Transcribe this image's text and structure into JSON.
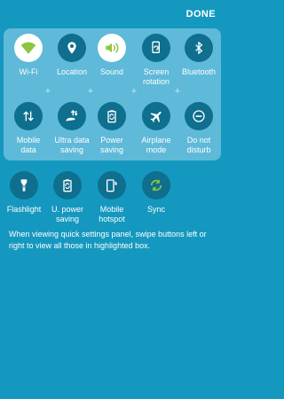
{
  "header": {
    "done_label": "DONE"
  },
  "panel": {
    "row1": [
      {
        "label": "Wi-Fi",
        "icon": "wifi-icon",
        "active": true
      },
      {
        "label": "Location",
        "icon": "location-pin-icon",
        "active": false
      },
      {
        "label": "Sound",
        "icon": "speaker-icon",
        "active": true
      },
      {
        "label": "Screen\nrotation",
        "icon": "screen-rotation-icon",
        "active": false
      },
      {
        "label": "Bluetooth",
        "icon": "bluetooth-icon",
        "active": false
      }
    ],
    "row2": [
      {
        "label": "Mobile\ndata",
        "icon": "mobile-data-icon",
        "active": false
      },
      {
        "label": "Ultra data\nsaving",
        "icon": "ultra-data-saving-icon",
        "active": false
      },
      {
        "label": "Power\nsaving",
        "icon": "battery-saving-icon",
        "active": false
      },
      {
        "label": "Airplane\nmode",
        "icon": "airplane-icon",
        "active": false
      },
      {
        "label": "Do not\ndisturb",
        "icon": "do-not-disturb-icon",
        "active": false
      }
    ]
  },
  "extra_buttons": [
    {
      "label": "Flashlight",
      "icon": "flashlight-icon"
    },
    {
      "label": "U. power\nsaving",
      "icon": "ultra-power-saving-icon"
    },
    {
      "label": "Mobile\nhotspot",
      "icon": "mobile-hotspot-icon"
    },
    {
      "label": "Sync",
      "icon": "sync-icon"
    }
  ],
  "hint_text": "When viewing quick settings panel, swipe buttons left or right to view all those in highlighted box.",
  "colors": {
    "background": "#1598bf",
    "panel": "#5fb9d8",
    "active_circle": "#ffffff",
    "inactive_circle": "#0e6f8f",
    "active_icon": "#8dc63f"
  }
}
